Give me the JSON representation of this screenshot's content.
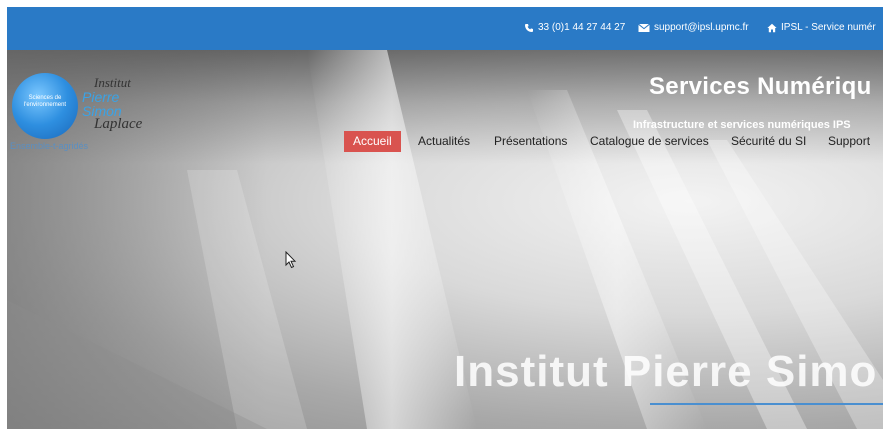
{
  "topbar": {
    "phone": "33 (0)1 44 27 44 27",
    "email": "support@ipsl.upmc.fr",
    "home_link": "IPSL - Service numér",
    "phone_icon": "phone-icon",
    "mail_icon": "envelope-icon",
    "home_icon": "home-icon",
    "background": "#2a7ac6"
  },
  "logo": {
    "circle_text": "Sciences de l'environnement",
    "word1": "Institut",
    "word2": "Pierre",
    "word3": "Simon",
    "word4": "Laplace",
    "tagline": "Ensemble-t-agridés"
  },
  "site": {
    "title": "Services Numériqu",
    "subtitle": "Infrastructure et services numériques IPS"
  },
  "nav": {
    "items": [
      {
        "label": "Accueil",
        "active": true
      },
      {
        "label": "Actualités"
      },
      {
        "label": "Présentations"
      },
      {
        "label": "Catalogue de services"
      },
      {
        "label": "Sécurité du SI"
      },
      {
        "label": "Support"
      }
    ],
    "active_color": "#d9534f"
  },
  "hero": {
    "heading": "Institut Pierre Simo",
    "rule_color": "#4a8fd0"
  }
}
